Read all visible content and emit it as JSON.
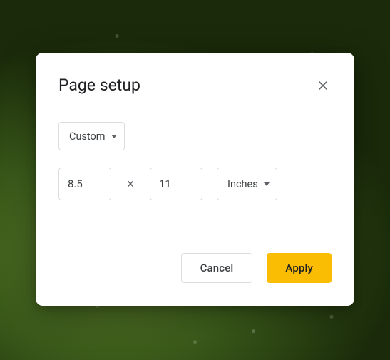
{
  "dialog": {
    "title": "Page setup",
    "preset": {
      "selected": "Custom"
    },
    "dimensions": {
      "width": "8.5",
      "height": "11",
      "separator": "×",
      "unit_selected": "Inches"
    },
    "actions": {
      "cancel": "Cancel",
      "apply": "Apply"
    }
  }
}
